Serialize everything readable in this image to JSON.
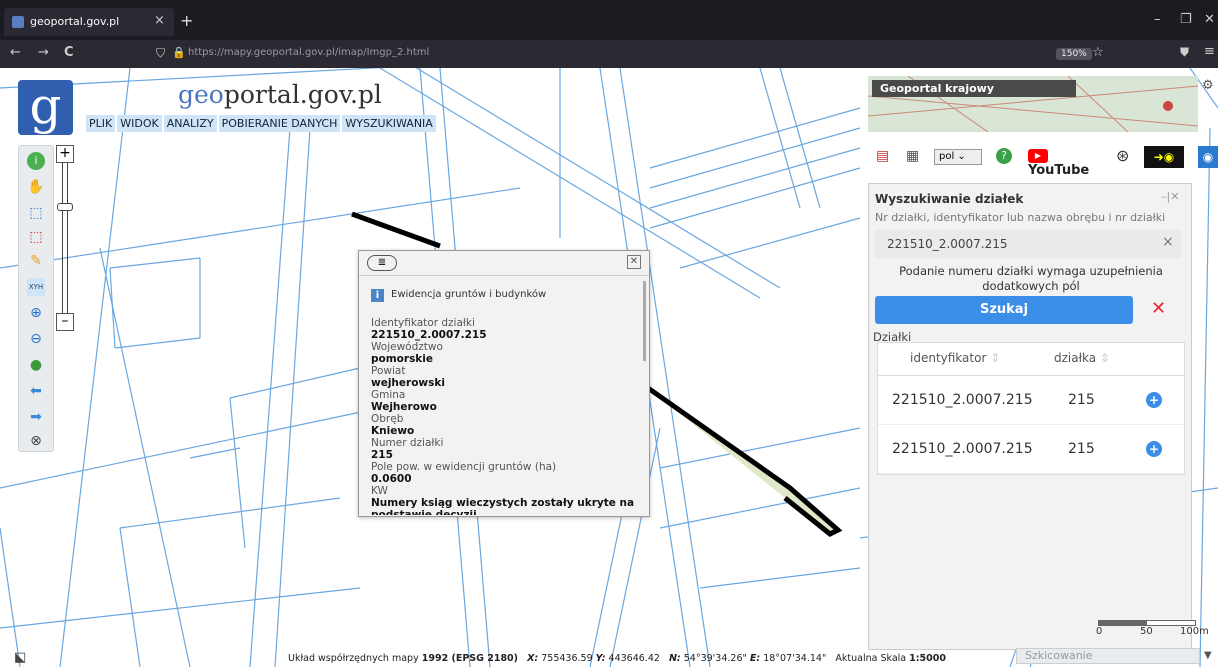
{
  "browser": {
    "tab_title": "geoportal.gov.pl",
    "tab_close": "×",
    "new_tab": "+",
    "url": "https://mapy.geoportal.gov.pl/imap/Imgp_2.html",
    "zoom": "150%",
    "win_minimize": "–",
    "win_restore": "❐",
    "win_close": "✕",
    "nav_back": "←",
    "nav_forward": "→",
    "nav_reload": "C"
  },
  "header": {
    "logo_letter": "g",
    "brand_prefix": "geo",
    "brand_rest": "portal.gov.pl",
    "menu": [
      "PLIK",
      "WIDOK",
      "ANALIZY",
      "POBIERANIE DANYCH",
      "WYSZUKIWANIA"
    ]
  },
  "toolbar": {
    "zoom_in": "+",
    "zoom_out": "–",
    "xyh_label": "XYH"
  },
  "popup": {
    "section_title": "Ewidencja gruntów i budynków",
    "fields": [
      {
        "label": "Identyfikator działki",
        "value": "221510_2.0007.215"
      },
      {
        "label": "Województwo",
        "value": "pomorskie"
      },
      {
        "label": "Powiat",
        "value": "wejherowski"
      },
      {
        "label": "Gmina",
        "value": "Wejherowo"
      },
      {
        "label": "Obręb",
        "value": "Kniewo"
      },
      {
        "label": "Numer działki",
        "value": "215"
      },
      {
        "label": "Pole pow. w ewidencji gruntów (ha)",
        "value": "0.0600"
      },
      {
        "label": "KW",
        "value": "Numery ksiąg wieczystych zostały ukryte na podstawie decyzji"
      }
    ]
  },
  "right_panel": {
    "minimap_title": "Geoportal krajowy",
    "lang_select": "pol",
    "youtube_label": "YouTube",
    "search": {
      "title": "Wyszukiwanie działek",
      "hint": "Nr działki, identyfikator lub nazwa obrębu i nr działki",
      "input_value": "221510_2.0007.215",
      "clear": "×",
      "note": "Podanie numeru działki wymaga uzupełnienia dodatkowych pól",
      "search_button": "Szukaj",
      "cancel": "✕",
      "results_label": "Działki",
      "col_id": "identyfikator",
      "col_parcel": "działka",
      "rows": [
        {
          "id": "221510_2.0007.215",
          "parcel": "215"
        },
        {
          "id": "221510_2.0007.215",
          "parcel": "215"
        }
      ]
    }
  },
  "status": {
    "prefix": "Układ współrzędnych mapy",
    "crs": "1992 (EPSG 2180)",
    "x_label": "X:",
    "x_value": "755436.59",
    "y_label": "Y:",
    "y_value": "443646.42",
    "n_label": "N:",
    "n_value": "54°39'34.26\"",
    "e_label": "E:",
    "e_value": "18°07'34.14\"",
    "scale_label": "Aktualna Skala",
    "scale_value": "1:5000"
  },
  "scalebar": {
    "t0": "0",
    "t1": "50",
    "t2": "100m"
  },
  "sketch_label": "Szkicowanie",
  "colors": {
    "accent": "#3b8ee8",
    "parcel_line": "#6aa7e0",
    "menu_bg": "#cfe4f7"
  }
}
